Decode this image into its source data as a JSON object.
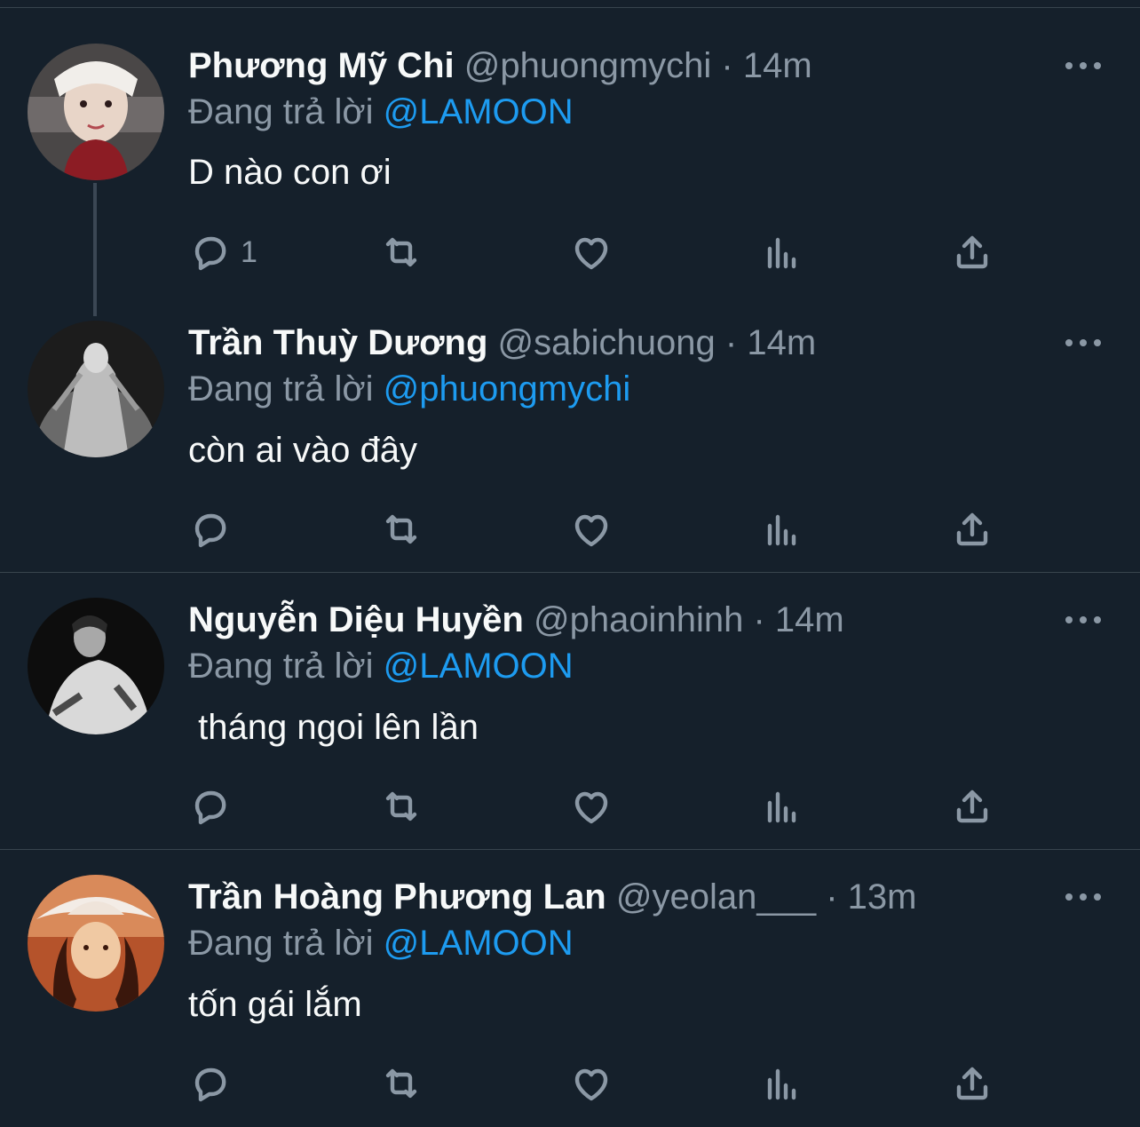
{
  "tweets": [
    {
      "name": "Phương Mỹ Chi",
      "handle": "@phuongmychi",
      "dot": "·",
      "time": "14m",
      "reply_prefix": "Đang trả lời",
      "reply_to": "@LAMOON",
      "text": "D nào con ơi",
      "reply_count": "1",
      "avatar_colors": [
        "#e8e2dc",
        "#8c1c24",
        "#2d2a2a"
      ]
    },
    {
      "name": "Trần Thuỳ Dương",
      "handle": "@sabichuong",
      "dot": "·",
      "time": "14m",
      "reply_prefix": "Đang trả lời",
      "reply_to": "@phuongmychi",
      "text": "còn ai vào đây",
      "reply_count": "",
      "avatar_colors": [
        "#bdbdbd",
        "#5a5a5a",
        "#1c1c1c"
      ]
    },
    {
      "name": "Nguyễn Diệu Huyền",
      "handle": "@phaoinhinh",
      "dot": "·",
      "time": "14m",
      "reply_prefix": "Đang trả lời",
      "reply_to": "@LAMOON",
      "text": " tháng ngoi lên lần",
      "reply_count": "",
      "avatar_colors": [
        "#d9d9d9",
        "#3a3a3a",
        "#0d0d0d"
      ]
    },
    {
      "name": "Trần Hoàng Phương Lan",
      "handle": "@yeolan___",
      "dot": "·",
      "time": "13m",
      "reply_prefix": "Đang trả lời",
      "reply_to": "@LAMOON",
      "text": "tốn gái lắm",
      "reply_count": "",
      "avatar_colors": [
        "#f0c9a3",
        "#b5532b",
        "#3a170c"
      ]
    }
  ]
}
